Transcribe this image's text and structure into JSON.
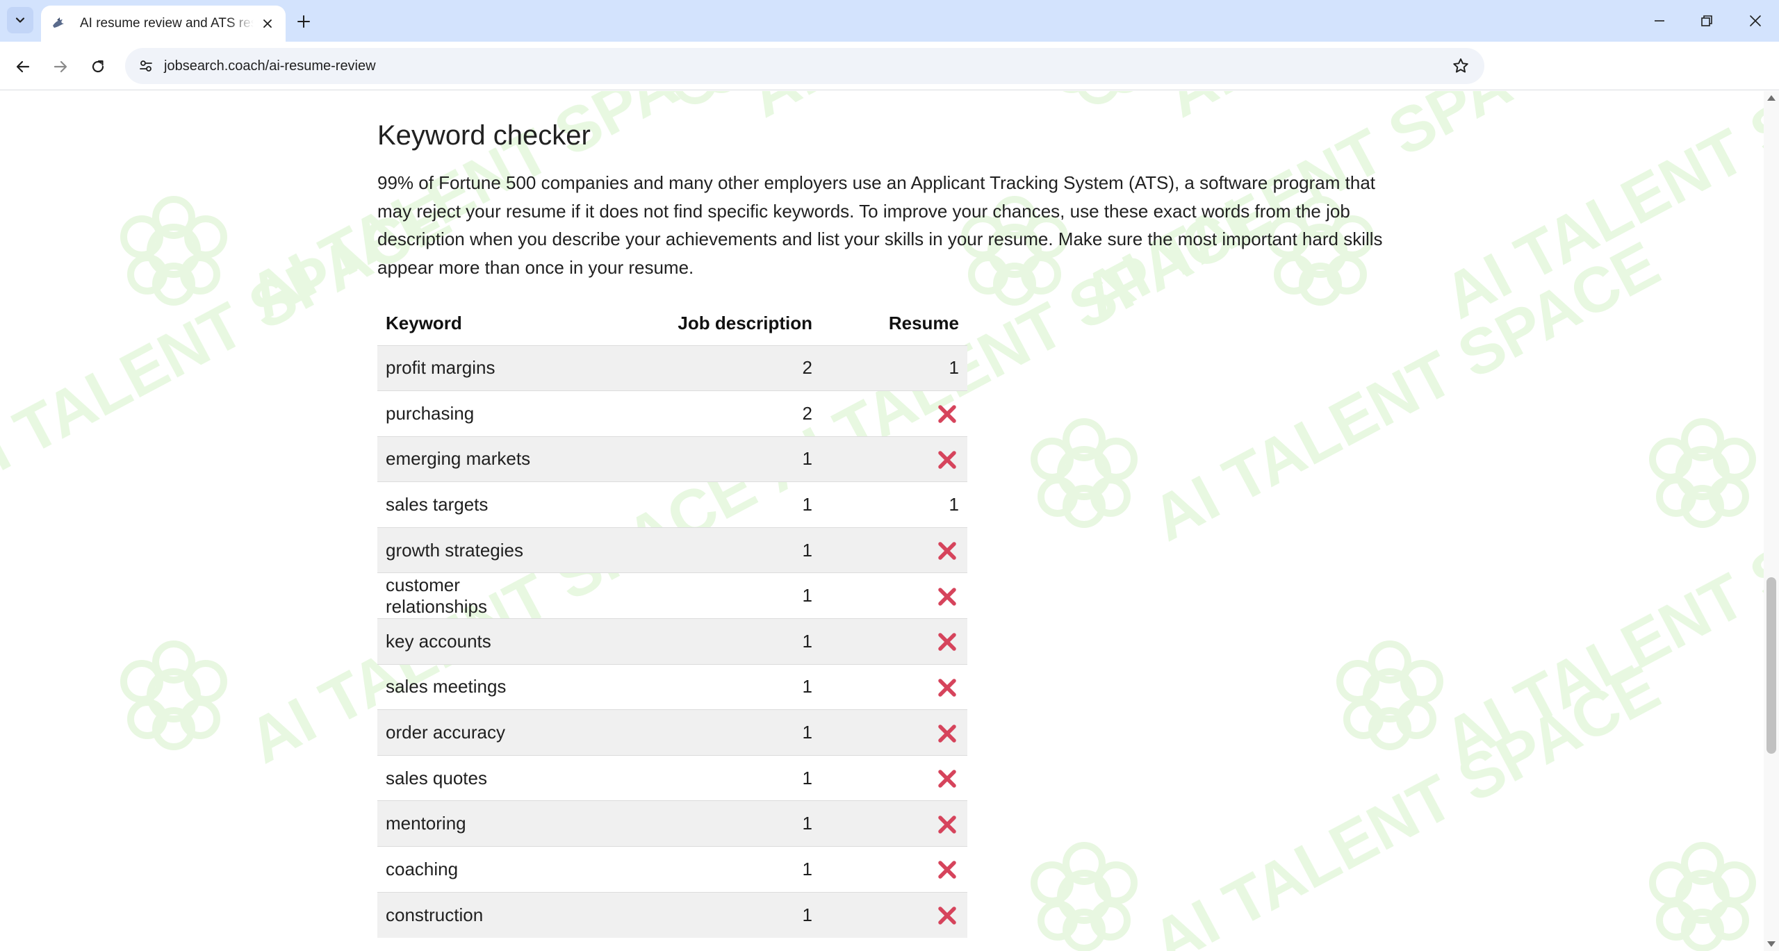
{
  "browser": {
    "tab_title": "AI resume review and ATS resume checker",
    "url": "jobsearch.coach/ai-resume-review"
  },
  "section": {
    "title": "Keyword checker",
    "intro": "99% of Fortune 500 companies and many other employers use an Applicant Tracking System (ATS), a software program that may reject your resume if it does not find specific keywords. To improve your chances, use these exact words from the job description when you describe your achievements and list your skills in your resume. Make sure the most important hard skills appear more than once in your resume."
  },
  "table": {
    "headers": [
      "Keyword",
      "Job description",
      "Resume"
    ],
    "rows": [
      {
        "keyword": "profit margins",
        "job": "2",
        "resume": "1"
      },
      {
        "keyword": "purchasing",
        "job": "2",
        "resume": null
      },
      {
        "keyword": "emerging markets",
        "job": "1",
        "resume": null
      },
      {
        "keyword": "sales targets",
        "job": "1",
        "resume": "1"
      },
      {
        "keyword": "growth strategies",
        "job": "1",
        "resume": null
      },
      {
        "keyword": "customer relationships",
        "job": "1",
        "resume": null
      },
      {
        "keyword": "key accounts",
        "job": "1",
        "resume": null
      },
      {
        "keyword": "sales meetings",
        "job": "1",
        "resume": null
      },
      {
        "keyword": "order accuracy",
        "job": "1",
        "resume": null
      },
      {
        "keyword": "sales quotes",
        "job": "1",
        "resume": null
      },
      {
        "keyword": "mentoring",
        "job": "1",
        "resume": null
      },
      {
        "keyword": "coaching",
        "job": "1",
        "resume": null
      },
      {
        "keyword": "construction",
        "job": "1",
        "resume": null
      }
    ],
    "missing_icon": "cross-mark-icon",
    "missing_color": "#d6445c"
  },
  "watermark": {
    "text": "AI TALENT SPACE",
    "color": "#e8f8e1"
  },
  "colors": {
    "tabstrip": "#d3e3fd",
    "omnibox": "#f0f3f9",
    "row_stripe": "#f0f0f0"
  }
}
